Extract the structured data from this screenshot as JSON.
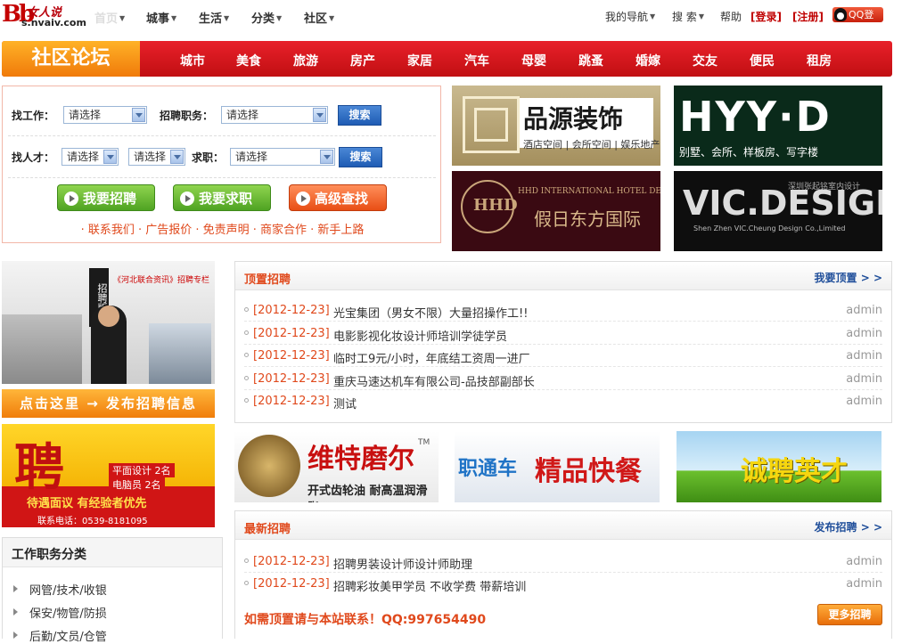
{
  "logo": {
    "letters": "Bb",
    "name": "女人说",
    "domain": "s.nvaiv.com"
  },
  "topnav": [
    {
      "label": "首页"
    },
    {
      "label": "城事"
    },
    {
      "label": "生活"
    },
    {
      "label": "分类"
    },
    {
      "label": "社区"
    }
  ],
  "rightnav": {
    "my_nav": "我的导航",
    "search": "搜 索",
    "help": "帮助",
    "login": "[登录]",
    "register": "[注册]",
    "qq_login": "QQ登录"
  },
  "mainnav": {
    "forum": "社区论坛",
    "items": [
      "城市",
      "美食",
      "旅游",
      "房产",
      "家居",
      "汽车",
      "母婴",
      "跳蚤",
      "婚嫁",
      "交友",
      "便民",
      "租房"
    ]
  },
  "search": {
    "find_job_label": "找工作：",
    "position_label": "招聘职务：",
    "find_talent_label": "找人才：",
    "seek_label": "求职：",
    "select_placeholder": "请选择",
    "search_button": "搜索",
    "recruit_button": "我要招聘",
    "apply_button": "我要求职",
    "advanced_button": "高级查找",
    "links": "· 联系我们 · 广告报价 · 免责声明 · 商家合作 · 新手上路"
  },
  "ads": {
    "pinyuan": {
      "title": "品源装饰",
      "sub": "酒店空间 | 会所空间 | 娱乐地产"
    },
    "hyy": {
      "title": "HYY·D",
      "sub": "别墅、会所、样板房、写字楼"
    },
    "hhd": {
      "en": "HHD INTERNATIONAL HOTEL DESIGNER",
      "cn": "假日东方国际",
      "mark": "HHD"
    },
    "vic": {
      "title": "VIC.DESIGN",
      "cn": "深圳张起铭室内设计",
      "en": "Shen Zhen VIC.Cheung Design Co.,Limited"
    },
    "weite": {
      "title": "维特磨尔",
      "tm": "TM",
      "sub": "开式齿轮油 耐高温润滑脂"
    },
    "zhitong": {
      "a": "职通车",
      "b": "精品快餐"
    },
    "chengpin": {
      "title": "诚聘英才"
    },
    "left1": {
      "tag": "招聘版",
      "sub": "《河北联合资讯》招聘专栏"
    },
    "left_button": "点击这里 → 发布招聘信息",
    "left2": {
      "big": "聘",
      "l1": "平面设计 2名",
      "l2": "电脑员 2名",
      "l3": "待遇面议 有经验者优先",
      "phone": "联系电话：0539-8181095"
    }
  },
  "top_jobs": {
    "title": "顶置招聘",
    "more": "我要顶置 > >",
    "rows": [
      {
        "date": "[2012-12-23]",
        "title": "光宝集团（男女不限）大量招操作工!!",
        "author": "admin"
      },
      {
        "date": "[2012-12-23]",
        "title": "电影影视化妆设计师培训学徒学员",
        "author": "admin"
      },
      {
        "date": "[2012-12-23]",
        "title": "临时工9元/小时，年底结工资周一进厂",
        "author": "admin"
      },
      {
        "date": "[2012-12-23]",
        "title": "重庆马速达机车有限公司-品技部副部长",
        "author": "admin"
      },
      {
        "date": "[2012-12-23]",
        "title": "测试",
        "author": "admin"
      }
    ]
  },
  "latest_jobs": {
    "title": "最新招聘",
    "more": "发布招聘 > >",
    "rows": [
      {
        "date": "[2012-12-23]",
        "title": "招聘男装设计师设计师助理",
        "author": "admin"
      },
      {
        "date": "[2012-12-23]",
        "title": "招聘彩妆美甲学员 不收学费 带薪培训",
        "author": "admin"
      }
    ],
    "note": "如需顶置请与本站联系！QQ:997654490",
    "more_button": "更多招聘"
  },
  "job_categories": {
    "title": "工作职务分类",
    "items": [
      "网管/技术/收银",
      "保安/物管/防损",
      "后勤/文员/仓管"
    ]
  }
}
